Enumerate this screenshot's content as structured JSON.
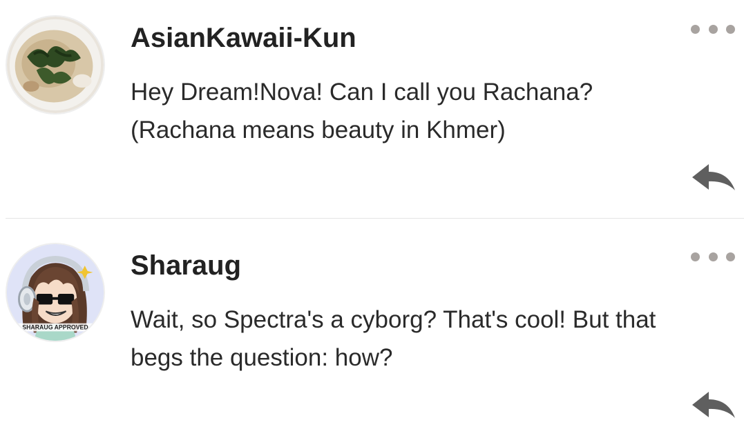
{
  "comments": [
    {
      "username": "AsianKawaii-Kun",
      "text_line1": "Hey Dream!Nova! Can I call you Rachana?",
      "text_line2": "(Rachana means beauty in Khmer)"
    },
    {
      "username": "Sharaug",
      "text_line1": "Wait, so Spectra's a cyborg? That's cool! But that",
      "text_line2": "begs the question: how?",
      "avatar_caption": "SHARAUG APPROVED"
    }
  ],
  "icons": {
    "more": "more-options-icon",
    "reply": "reply-icon"
  },
  "colors": {
    "icon_gray": "#5f5f5f",
    "dots_gray": "#a8a3a0",
    "divider": "#e4e4e4",
    "text": "#222222"
  }
}
